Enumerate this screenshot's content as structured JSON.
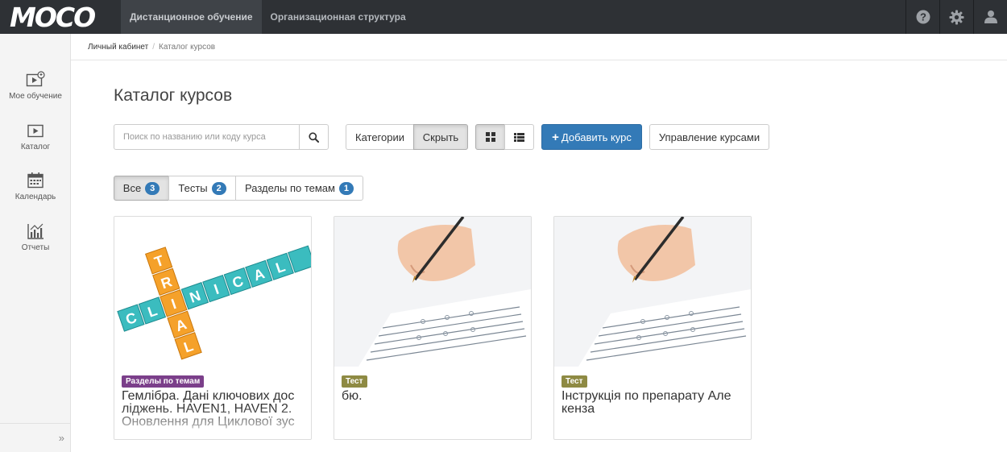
{
  "app": {
    "logo": "MOCO"
  },
  "topnav": [
    {
      "label": "Дистанционное обучение"
    },
    {
      "label": "Организационная структура"
    }
  ],
  "topicons": [
    "help-icon",
    "gear-icon",
    "user-icon"
  ],
  "sidebar": {
    "items": [
      {
        "label": "Мое обучение",
        "icon": "my-learning-icon"
      },
      {
        "label": "Каталог",
        "icon": "catalog-icon"
      },
      {
        "label": "Календарь",
        "icon": "calendar-icon"
      },
      {
        "label": "Отчеты",
        "icon": "reports-icon"
      }
    ],
    "collapse": "»"
  },
  "breadcrumb": {
    "home": "Личный кабинет",
    "separator": "/",
    "current": "Каталог курсов"
  },
  "page": {
    "title": "Каталог курсов"
  },
  "toolbar": {
    "search_placeholder": "Поиск по названию или коду курса",
    "categories_label": "Категории",
    "hide_label": "Скрыть",
    "add_course_label": "Добавить курс",
    "manage_courses_label": "Управление курсами"
  },
  "filters": [
    {
      "label": "Все",
      "count": "3"
    },
    {
      "label": "Тесты",
      "count": "2"
    },
    {
      "label": "Разделы по темам",
      "count": "1"
    }
  ],
  "colors": {
    "primary": "#337ab7",
    "topbar": "#2e3135",
    "tag_sections": "#7b3f8a",
    "tag_test": "#8e8a43"
  },
  "cards": [
    {
      "tag": "Разделы по темам",
      "title": "Гемлібра. Дані ключових дос ліджень. HAVEN1, HAVEN 2. Оновлення для Циклової зус",
      "image": "clinical-trial-image"
    },
    {
      "tag": "Тест",
      "title": "бю.",
      "image": "hand-writing-test-image"
    },
    {
      "tag": "Тест",
      "title": "Інструкція по препарату Але кенза",
      "image": "hand-writing-test-image"
    }
  ]
}
